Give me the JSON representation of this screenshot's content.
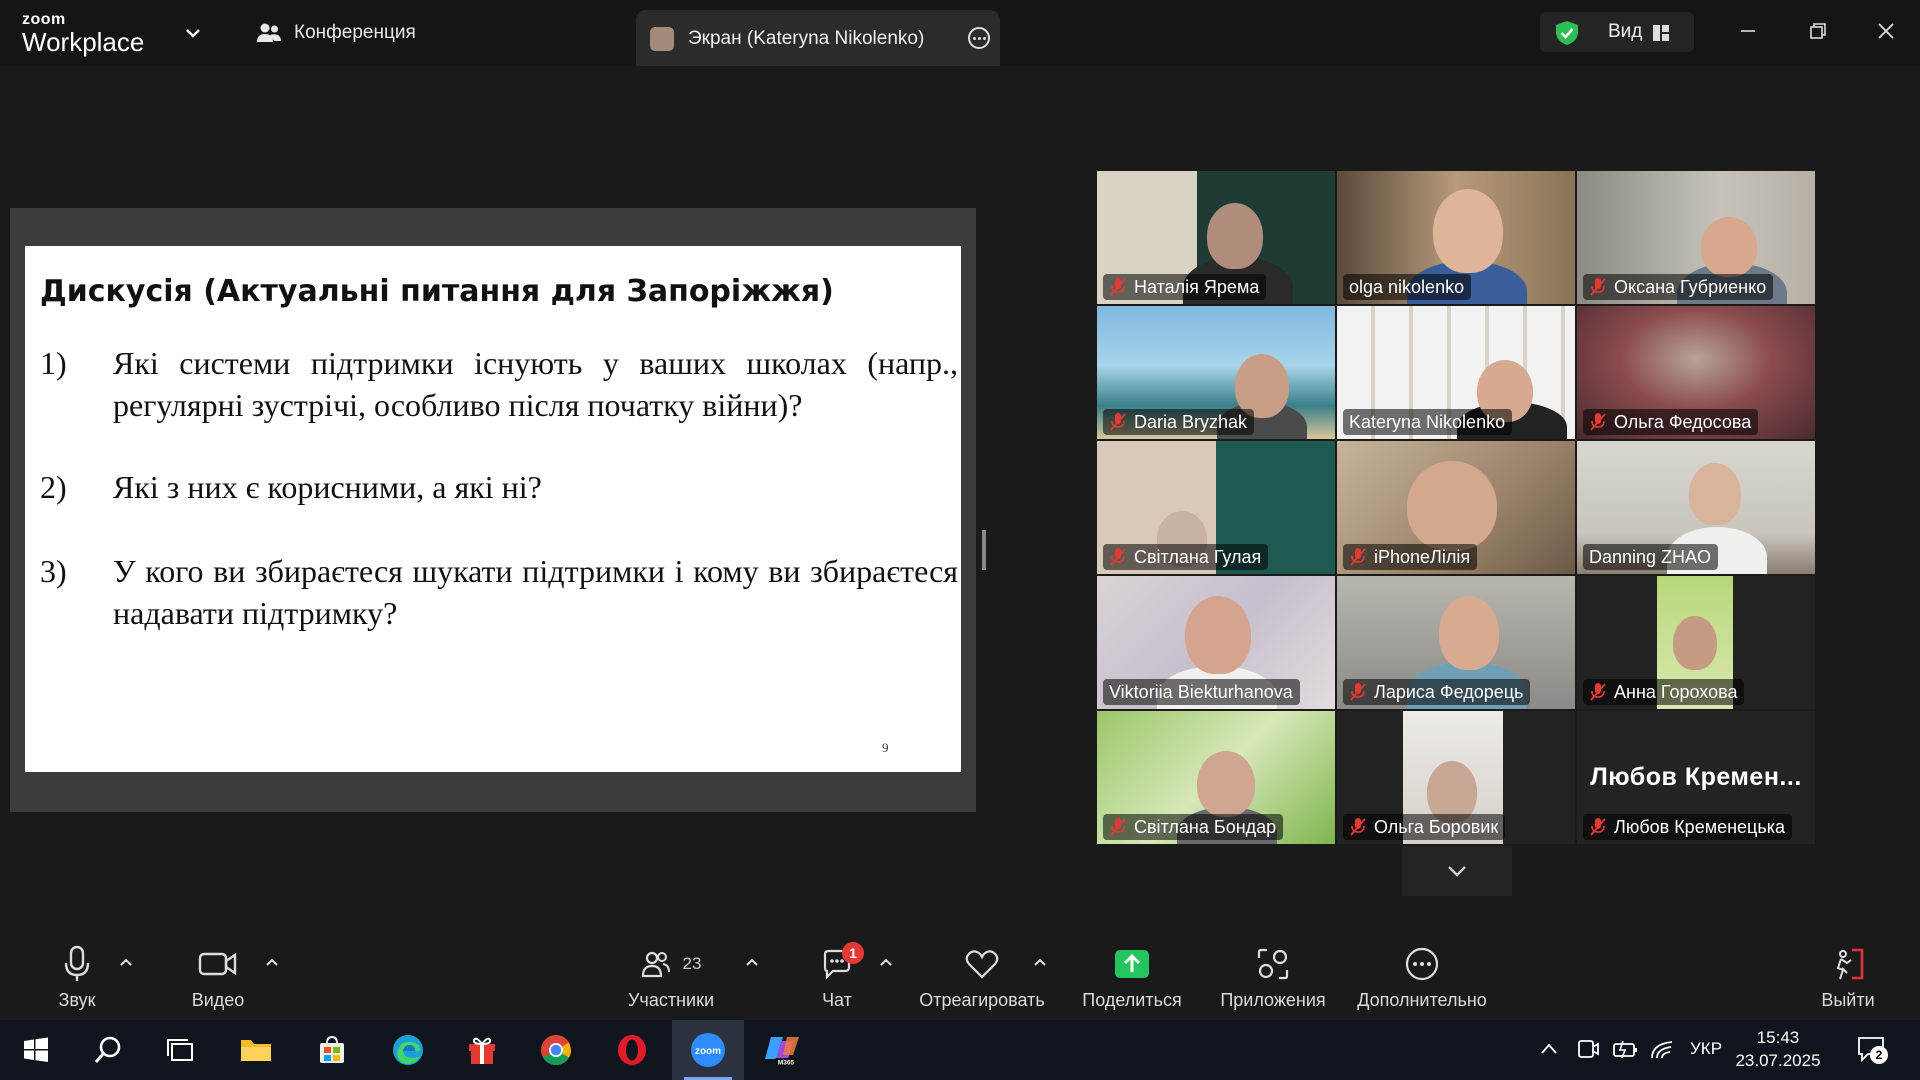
{
  "titlebar": {
    "brand_small": "zoom",
    "brand_large": "Workplace",
    "conference_tab": "Конференция",
    "screen_tab": "Экран (Kateryna Nikolenko)",
    "view_label": "Вид"
  },
  "slide": {
    "title": "Дискусія (Актуальні питання для Запоріжжя)",
    "questions": [
      {
        "num": "1)",
        "text": "Які системи підтримки існують у ваших школах (напр., регулярні зустрічі, особливо після початку війни)?"
      },
      {
        "num": "2)",
        "text": "Які з них є корисними, а які ні?"
      },
      {
        "num": "3)",
        "text": "У кого ви збираєтеся шукати підтримки і кому ви збираєтеся надавати підтримку?"
      }
    ],
    "page_number": "9"
  },
  "participants": [
    {
      "name": "Наталія Ярема",
      "muted": true
    },
    {
      "name": "olga nikolenko",
      "muted": false
    },
    {
      "name": "Оксана Губриенко",
      "muted": true
    },
    {
      "name": "Daria Bryzhak",
      "muted": true
    },
    {
      "name": "Kateryna Nikolenko",
      "muted": false
    },
    {
      "name": "Ольга Федосова",
      "muted": true
    },
    {
      "name": "Світлана Гулая",
      "muted": true
    },
    {
      "name": "iPhoneЛілія",
      "muted": true
    },
    {
      "name": "Danning ZHAO",
      "muted": false
    },
    {
      "name": "Viktoriia Biekturhanova",
      "muted": false,
      "speaking": true
    },
    {
      "name": "Лариса Федорець",
      "muted": true
    },
    {
      "name": "Анна Горохова",
      "muted": true
    },
    {
      "name": "Світлана Бондар",
      "muted": true
    },
    {
      "name": "Ольга Боровик",
      "muted": true
    },
    {
      "name": "Любов Кременецька",
      "muted": true,
      "video_off": true,
      "display_name": "Любов  Кремен..."
    }
  ],
  "controls": {
    "audio": "Звук",
    "video": "Видео",
    "participants": "Участники",
    "participants_count": "23",
    "chat": "Чат",
    "chat_badge": "1",
    "react": "Отреагировать",
    "share": "Поделиться",
    "apps": "Приложения",
    "more": "Дополнительно",
    "leave": "Выйти"
  },
  "taskbar": {
    "lang": "УКР",
    "time": "15:43",
    "date": "23.07.2025",
    "notif_count": "2",
    "app_icons": [
      "windows-start",
      "search",
      "task-view",
      "file-explorer",
      "microsoft-store",
      "edge",
      "gift-app",
      "chrome",
      "opera",
      "zoom",
      "m365-copilot"
    ]
  },
  "colors": {
    "accent_green": "#3bd46b",
    "share_green": "#22c55e",
    "badge_red": "#e53935",
    "leave_red": "#e0323c"
  }
}
